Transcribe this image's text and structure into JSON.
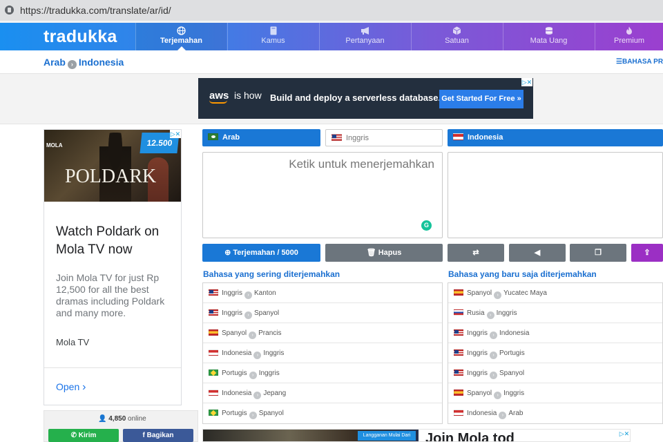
{
  "browser": {
    "url": "https://tradukka.com/translate/ar/id/"
  },
  "header": {
    "logo": "tradukka",
    "nav": [
      {
        "label": "Terjemahan",
        "icon": "globe-icon"
      },
      {
        "label": "Kamus",
        "icon": "book-icon"
      },
      {
        "label": "Pertanyaan",
        "icon": "megaphone-icon"
      },
      {
        "label": "Satuan",
        "icon": "cube-icon"
      },
      {
        "label": "Mata Uang",
        "icon": "coins-icon"
      },
      {
        "label": "Premium",
        "icon": "flame-icon"
      }
    ]
  },
  "breadcrumb": {
    "from": "Arab",
    "to": "Indonesia",
    "site_lang": "BAHASA PRE"
  },
  "top_ad": {
    "brand": "aws",
    "brand_suffix": "is how",
    "text": "Build and deploy a serverless database.",
    "button": "Get Started For Free »"
  },
  "side_ad": {
    "brand": "MOLA",
    "show": "POLDARK",
    "price": "12.500",
    "title": "Watch Poldark on Mola TV now",
    "description": "Join Mola TV for just Rp 12,500 for all the best dramas including Poldark and many more.",
    "source": "Mola TV",
    "cta": "Open"
  },
  "online": {
    "count": "4,850",
    "label": "online"
  },
  "share": {
    "whatsapp": "Kirim",
    "facebook": "Bagikan"
  },
  "translator": {
    "source_lang": "Arab",
    "alt_lang": "Inggris",
    "target_lang": "Indonesia",
    "placeholder": "Ketik untuk menerjemahkan",
    "translate_button": "Terjemahan / 5000",
    "clear_button": "Hapus"
  },
  "frequent": {
    "title": "Bahasa yang sering diterjemahkan",
    "pairs": [
      {
        "from": "Inggris",
        "to": "Kanton",
        "flag": "us"
      },
      {
        "from": "Inggris",
        "to": "Spanyol",
        "flag": "us"
      },
      {
        "from": "Spanyol",
        "to": "Prancis",
        "flag": "es"
      },
      {
        "from": "Indonesia",
        "to": "Inggris",
        "flag": "id"
      },
      {
        "from": "Portugis",
        "to": "Inggris",
        "flag": "br"
      },
      {
        "from": "Indonesia",
        "to": "Jepang",
        "flag": "id"
      },
      {
        "from": "Portugis",
        "to": "Spanyol",
        "flag": "br"
      }
    ]
  },
  "recent": {
    "title": "Bahasa yang baru saja diterjemahkan",
    "pairs": [
      {
        "from": "Spanyol",
        "to": "Yucatec Maya",
        "flag": "es"
      },
      {
        "from": "Rusia",
        "to": "Inggris",
        "flag": "ru"
      },
      {
        "from": "Inggris",
        "to": "Indonesia",
        "flag": "us"
      },
      {
        "from": "Inggris",
        "to": "Portugis",
        "flag": "us"
      },
      {
        "from": "Inggris",
        "to": "Spanyol",
        "flag": "us"
      },
      {
        "from": "Spanyol",
        "to": "Inggris",
        "flag": "es"
      },
      {
        "from": "Indonesia",
        "to": "Arab",
        "flag": "id"
      }
    ]
  },
  "bottom_ad": {
    "tag": "Langganan Mulai Dari",
    "text": "Join Mola tod"
  }
}
